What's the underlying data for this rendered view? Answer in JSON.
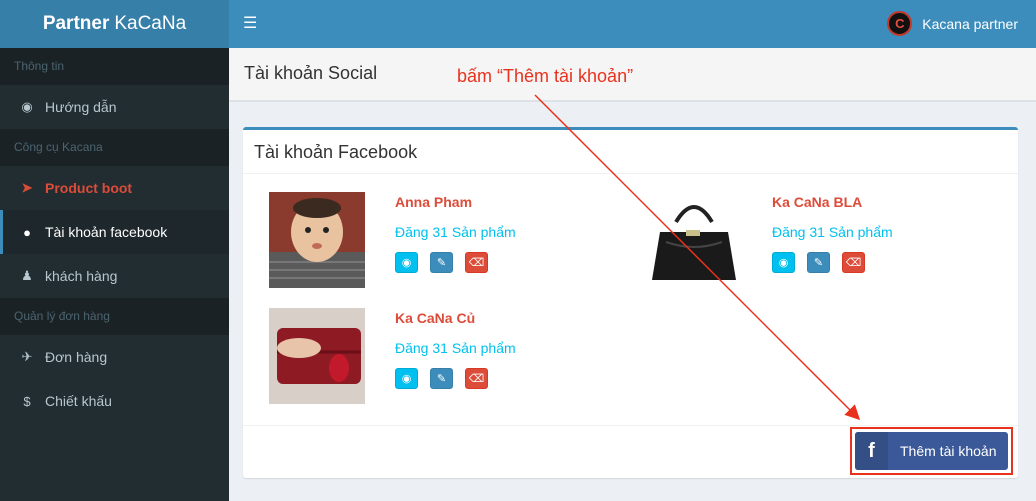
{
  "logo": {
    "bold": "Partner",
    "light": "KaCaNa"
  },
  "topbar": {
    "menu_icon": "bars-icon",
    "user_name": "Kacana partner",
    "avatar_letter": "C"
  },
  "sidebar": {
    "sections": [
      {
        "header": "Thông tin",
        "items": [
          {
            "label": "Hướng dẫn",
            "icon": "dashboard-icon"
          }
        ]
      },
      {
        "header": "Công cụ Kacana",
        "items": [
          {
            "label": "Product boot",
            "icon": "rocket-icon"
          },
          {
            "label": "Tài khoản facebook",
            "icon": "globe-icon"
          },
          {
            "label": "khách hàng",
            "icon": "user-icon"
          }
        ]
      },
      {
        "header": "Quản lý đơn hàng",
        "items": [
          {
            "label": "Đơn hàng",
            "icon": "plane-icon"
          },
          {
            "label": "Chiết khấu",
            "icon": "dollar-icon"
          }
        ]
      }
    ]
  },
  "page": {
    "title": "Tài khoản Social",
    "annotation": "bấm “Thêm tài khoản”"
  },
  "box": {
    "title": "Tài khoản Facebook",
    "accounts": [
      {
        "name": "Anna Pham",
        "count": "Đăng 31 Sản phẩm"
      },
      {
        "name": "Ka CaNa BLA",
        "count": "Đăng 31 Sản phẩm"
      },
      {
        "name": "Ka CaNa Củ",
        "count": "Đăng 31 Sản phẩm"
      }
    ],
    "add_label": "Thêm tài khoản",
    "add_icon_letter": "f"
  },
  "colors": {
    "accent": "#3c8dbc",
    "danger": "#dd4b39",
    "info": "#00c0ef",
    "facebook": "#3b5998",
    "annotation": "#e8321e"
  }
}
